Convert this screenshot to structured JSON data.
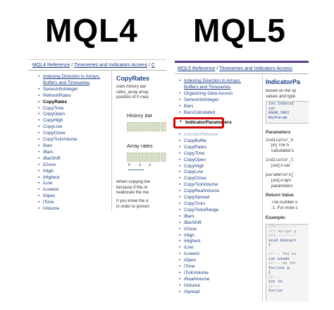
{
  "titles": {
    "left": "MQL4",
    "right": "MQL5"
  },
  "mql4": {
    "breadcrumb": [
      "MQL4 Reference",
      "Timeseries and Indicators Access",
      "C"
    ],
    "toc": [
      "Indexing Direction in Arrays, Buffers and Timeseries",
      "SeriesInfoInteger",
      "RefreshRates",
      "CopyRates",
      "CopyTime",
      "CopyOpen",
      "CopyHigh",
      "CopyLow",
      "CopyClose",
      "CopyTickVolume",
      "Bars",
      "iBars",
      "iBarShift",
      "iClose",
      "iHigh",
      "iHighest",
      "iLow",
      "iLowest",
      "iOpen",
      "iTime",
      "iVolume"
    ],
    "current_index": 3,
    "content": {
      "title": "CopyRates",
      "intro": [
        "Gets history dat",
        "rates_array array",
        "position of 0 mea"
      ],
      "history_label": "History dat",
      "array_label": "Array rates",
      "array_ticks": [
        "0",
        "1",
        "2"
      ],
      "para1": [
        "When copying the",
        "because if the re",
        "reallocate the me"
      ],
      "para2": [
        "If you know the a",
        "in order to preven"
      ]
    }
  },
  "mql5": {
    "breadcrumb": [
      "MQL5 Reference",
      "Timeseries and Indicators Access"
    ],
    "toc_top": [
      "Indexing Direction in Arrays, Buffers and Timeseries",
      "Organizing Data Access",
      "SeriesInfoInteger",
      "Bars",
      "BarsCalculated"
    ],
    "highlighted": "IndicatorParameters",
    "toc_bottom": [
      "IndicatorRelease",
      "CopyBuffer",
      "CopyRates",
      "CopyTime",
      "CopyOpen",
      "CopyHigh",
      "CopyLow",
      "CopyClose",
      "CopyTickVolume",
      "CopyRealVolume",
      "CopySpread",
      "CopyTicks",
      "CopyTicksRange",
      "iBars",
      "iBarShift",
      "iClose",
      "iHigh",
      "iHighest",
      "iLow",
      "iLowest",
      "iOpen",
      "iTime",
      "iTickVolume",
      "iRealVolume",
      "iVolume",
      "iSpread"
    ],
    "content": {
      "title": "IndicatorPa",
      "intro": [
        "Based on the sp",
        "values and type"
      ],
      "code1": [
        "int  Indicat",
        "  int",
        "  ENUM_INDI",
        "  MqlParam"
      ],
      "parameters_label": "Parameters",
      "params": [
        {
          "name": "indicator_h",
          "desc": [
            "[in]  The h",
            "calculated o"
          ]
        },
        {
          "name": "indicator_t",
          "desc": [
            "[out] A var"
          ]
        },
        {
          "name": "parameters[",
          "desc": [
            "[out] A dyn",
            "parameters"
          ]
        }
      ],
      "return_label": "Return Value",
      "return_text": [
        "The number o",
        "-1. For more c"
      ],
      "example_label": "Example:",
      "code2": [
        "//+---------",
        "//| Script p",
        "//+---------",
        "void OnStart",
        "  {",
        "",
        "//--- The nu",
        "   int windo",
        "//--- Go thr",
        "   for(int w",
        "      {",
        "      //---",
        "      int to",
        "      //---",
        "      for(in"
      ]
    }
  }
}
